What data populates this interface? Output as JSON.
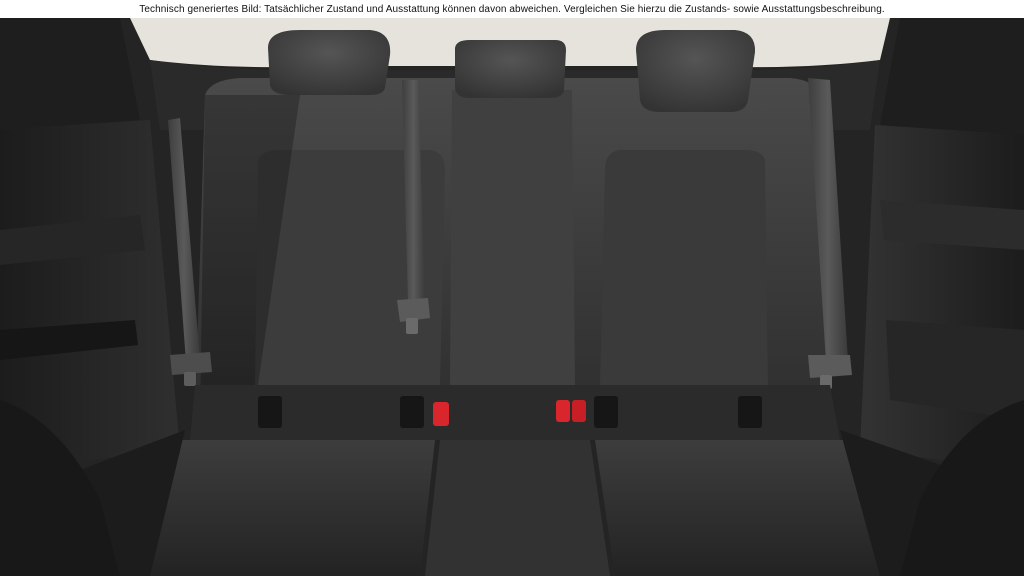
{
  "disclaimer": {
    "text": "Technisch generiertes Bild: Tatsächlicher Zustand und Ausstattung können davon abweichen. Vergleichen Sie hierzu die Zustands- sowie Ausstattungsbeschreibung."
  },
  "colors": {
    "background": "#1b1b1b",
    "disclaimer_bg": "#ffffff",
    "disclaimer_text": "#111111",
    "upholstery": "#3a3a3a",
    "headliner": "#e6e3dc",
    "isofix_marker": "#d8262c"
  }
}
